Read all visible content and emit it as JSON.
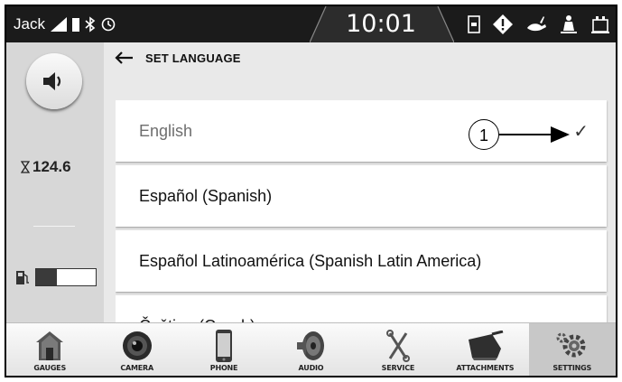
{
  "status_bar": {
    "user": "Jack",
    "time": "10:01"
  },
  "left_rail": {
    "hour_meter": "124.6",
    "fuel_level": 0.35
  },
  "header": {
    "title": "SET LANGUAGE"
  },
  "languages": [
    {
      "label": "English",
      "selected": true
    },
    {
      "label": "Español (Spanish)",
      "selected": false
    },
    {
      "label": "Español Latinoamérica (Spanish Latin America)",
      "selected": false
    },
    {
      "label": "Čeština (Czech)",
      "selected": false
    }
  ],
  "callout": {
    "number": "1"
  },
  "bottom_nav": [
    {
      "label": "GAUGES",
      "icon": "house-icon"
    },
    {
      "label": "CAMERA",
      "icon": "camera-icon"
    },
    {
      "label": "PHONE",
      "icon": "phone-icon"
    },
    {
      "label": "AUDIO",
      "icon": "speaker-icon"
    },
    {
      "label": "SERVICE",
      "icon": "tools-icon"
    },
    {
      "label": "ATTACHMENTS",
      "icon": "bucket-icon"
    },
    {
      "label": "SETTINGS",
      "icon": "gear-icon",
      "active": true
    }
  ]
}
